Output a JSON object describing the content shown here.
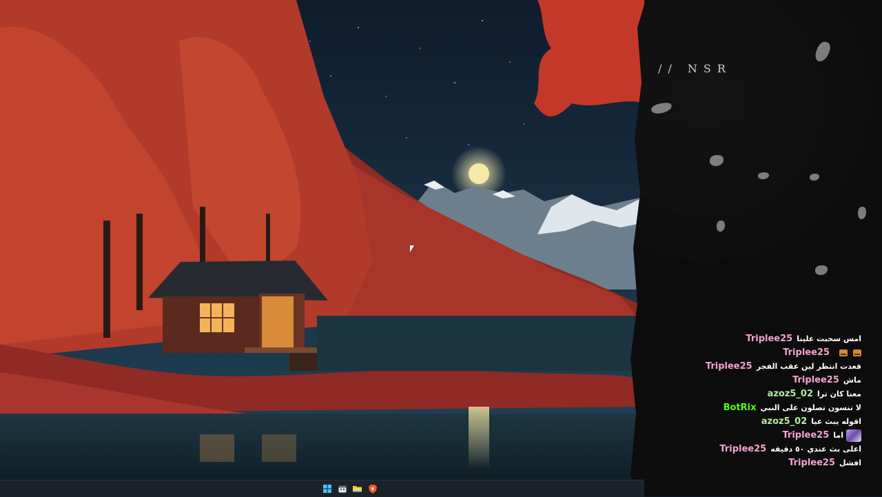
{
  "overlay": {
    "title": "// NSR",
    "accent_color": "#0b0b0b"
  },
  "chat": {
    "messages": [
      {
        "user": "Triplee25",
        "user_color": "#f4a3d0",
        "text": "امس سحبت علينا",
        "badges": [],
        "emotes": []
      },
      {
        "user": "Triplee25",
        "user_color": "#f4a3d0",
        "text": "",
        "badges": [],
        "emotes": [
          "emote-icon",
          "emote-icon"
        ]
      },
      {
        "user": "Triplee25",
        "user_color": "#f4a3d0",
        "text": "قعدت انتظر لين عقب الفجر",
        "badges": [],
        "emotes": []
      },
      {
        "user": "Triplee25",
        "user_color": "#f4a3d0",
        "text": "ماش",
        "badges": [],
        "emotes": []
      },
      {
        "user": "azoz5_02",
        "user_color": "#b7e8a6",
        "text": "معنا كان ترا",
        "badges": [],
        "emotes": []
      },
      {
        "user": "BotRix",
        "user_color": "#53fc18",
        "text": "لا تنسون تصلون على النبي",
        "badges": [
          "bot-badge-icon",
          "verified-badge-icon"
        ],
        "emotes": []
      },
      {
        "user": "azoz5_02",
        "user_color": "#b7e8a6",
        "text": "اقوله يبث عيا",
        "badges": [],
        "emotes": []
      },
      {
        "user": "Triplee25",
        "user_color": "#f4a3d0",
        "text": "اما",
        "badges": [],
        "emotes": [
          "anime-emote-icon"
        ]
      },
      {
        "user": "Triplee25",
        "user_color": "#f4a3d0",
        "text": "اعلى بث عندي ٥٠ دقيقه",
        "badges": [],
        "emotes": []
      },
      {
        "user": "Triplee25",
        "user_color": "#f4a3d0",
        "text": "افشل",
        "badges": [],
        "emotes": []
      }
    ]
  },
  "taskbar": {
    "icons": [
      "windows-start-icon",
      "calendar-app-icon",
      "file-explorer-icon",
      "brave-browser-icon"
    ]
  },
  "colors": {
    "sky": "#14243a",
    "foliage": "#b23a2a",
    "water": "#1c3a48",
    "moon": "#f6e9a8"
  }
}
